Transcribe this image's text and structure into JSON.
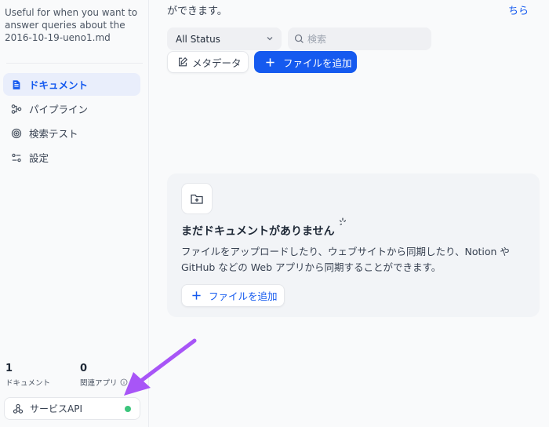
{
  "sidebar": {
    "description": "Useful for when you want to answer queries about the 2016-10-19-ueno1.md",
    "nav": [
      {
        "label": "ドキュメント",
        "icon": "document-icon",
        "active": true
      },
      {
        "label": "パイプライン",
        "icon": "pipeline-icon",
        "active": false
      },
      {
        "label": "検索テスト",
        "icon": "target-icon",
        "active": false
      },
      {
        "label": "設定",
        "icon": "settings-sliders-icon",
        "active": false
      }
    ],
    "stats": {
      "documents": {
        "value": "1",
        "label": "ドキュメント"
      },
      "related_apps": {
        "value": "0",
        "label": "関連アプリ"
      }
    },
    "service_api": {
      "label": "サービスAPI",
      "status_color": "#3cc57c"
    }
  },
  "main": {
    "top_text": "ができます。",
    "top_link": "ちら",
    "filter": {
      "status_value": "All Status",
      "search_placeholder": "検索"
    },
    "buttons": {
      "metadata": "メタデータ",
      "add_file": "ファイルを追加"
    },
    "empty_state": {
      "title": "まだドキュメントがありません",
      "description": "ファイルをアップロードしたり、ウェブサイトから同期したり、Notion や GitHub などの Web アプリから同期することができます。",
      "add_button": "ファイルを追加"
    }
  },
  "colors": {
    "accent": "#155aef",
    "annotation_arrow": "#a855f7"
  }
}
